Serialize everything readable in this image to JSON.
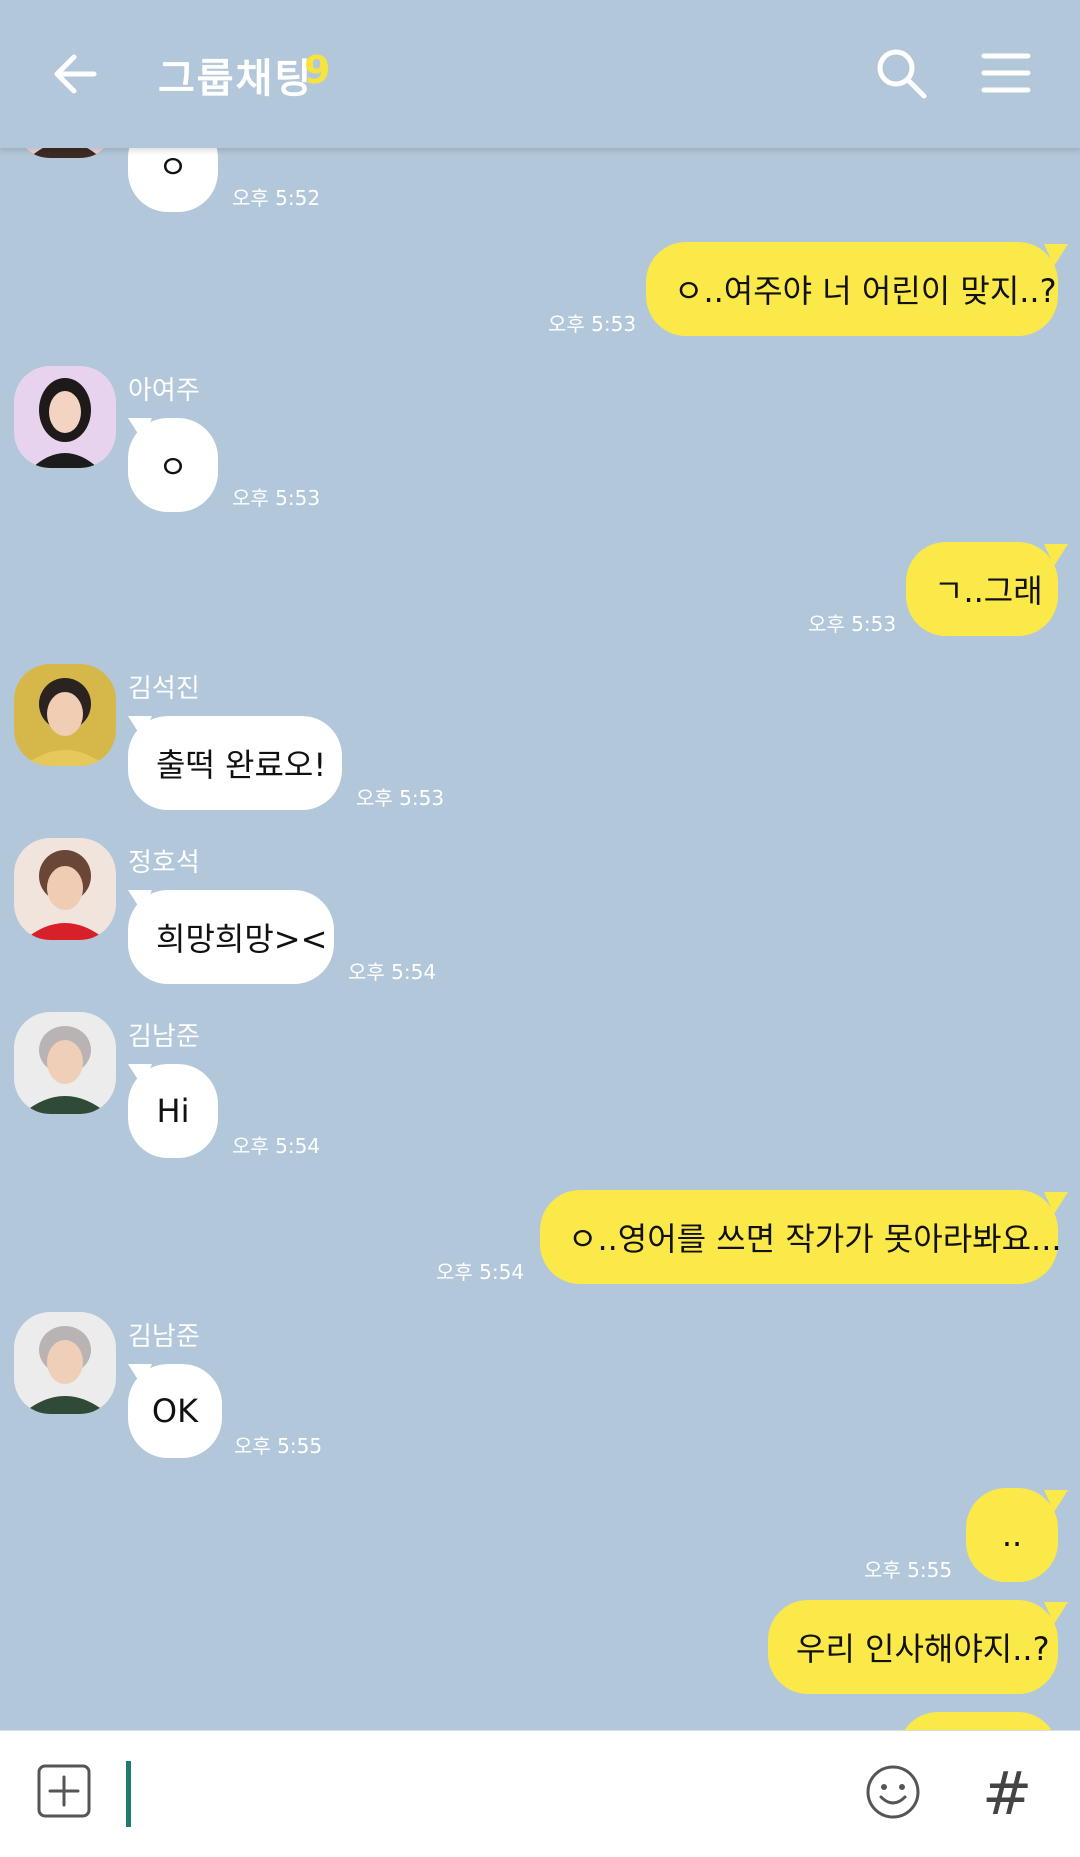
{
  "header": {
    "title": "그룹채팅",
    "member_count": "9"
  },
  "messages": [
    {
      "id": "m0",
      "side": "in",
      "text": "ㅇ",
      "time": "오후 5:52"
    },
    {
      "id": "m1",
      "side": "out",
      "text": "ㅇ..여주야 너 어린이 맞지..?",
      "time": "오후 5:53"
    },
    {
      "id": "m2",
      "side": "in",
      "sender": "아여주",
      "text": "ㅇ",
      "time": "오후 5:53"
    },
    {
      "id": "m3",
      "side": "out",
      "text": "ㄱ..그래",
      "time": "오후 5:53"
    },
    {
      "id": "m4",
      "side": "in",
      "sender": "김석진",
      "text": "출떡 완료오!",
      "time": "오후 5:53"
    },
    {
      "id": "m5",
      "side": "in",
      "sender": "정호석",
      "text": "희망희망><",
      "time": "오후 5:54"
    },
    {
      "id": "m6",
      "side": "in",
      "sender": "김남준",
      "text": "Hi",
      "time": "오후 5:54"
    },
    {
      "id": "m7",
      "side": "out",
      "text": "ㅇ..영어를 쓰면 작가가 못아라봐요...",
      "time": "오후 5:54"
    },
    {
      "id": "m8",
      "side": "in",
      "sender": "김남준",
      "text": "OK",
      "time": "오후 5:55"
    },
    {
      "id": "m9",
      "side": "out",
      "text": "..",
      "time": "오후 5:55"
    },
    {
      "id": "m10",
      "side": "out",
      "text": "우리 인사해야지..?",
      "time": ""
    }
  ],
  "input": {
    "placeholder": "",
    "hash_symbol": "#"
  },
  "colors": {
    "background": "#b2c7da",
    "outgoing_bubble": "#fbe94a",
    "incoming_bubble": "#ffffff",
    "count_accent": "#f7e33e",
    "cursor": "#1d7a6e"
  },
  "icons": [
    "back-arrow-icon",
    "search-icon",
    "menu-icon",
    "plus-icon",
    "emoji-icon"
  ]
}
